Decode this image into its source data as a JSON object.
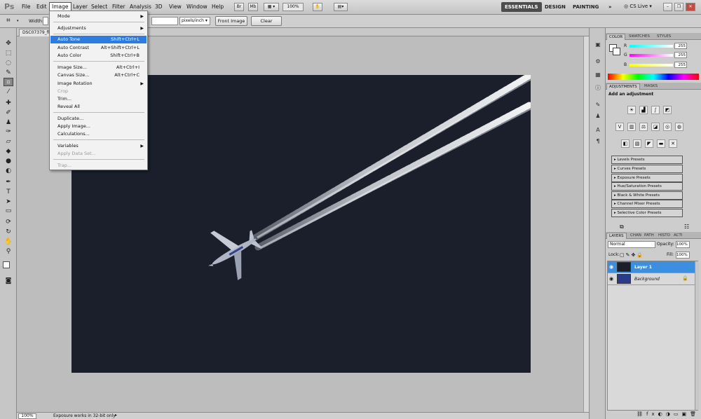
{
  "menubar": {
    "logo": "Ps",
    "items": [
      "File",
      "Edit",
      "Image",
      "Layer",
      "Select",
      "Filter",
      "Analysis",
      "3D",
      "View",
      "Window",
      "Help"
    ],
    "zoom": "100%",
    "workspaces": [
      "ESSENTIALS",
      "DESIGN",
      "PAINTING"
    ],
    "cs_live": "CS Live",
    "more": "»"
  },
  "options": {
    "width_label": "Width:",
    "resolution_units": "pixels/inch",
    "front_image": "Front Image",
    "clear": "Clear"
  },
  "document": {
    "tab_title": "DSC07379_fil",
    "zoom": "100%",
    "status": "Exposure works in 32-bit only"
  },
  "image_menu": {
    "items": [
      {
        "label": "Mode",
        "shortcut": "",
        "submenu": true,
        "disabled": false
      },
      {
        "label": "Adjustments",
        "shortcut": "",
        "submenu": true,
        "disabled": false
      },
      {
        "label": "Auto Tone",
        "shortcut": "Shift+Ctrl+L",
        "submenu": false,
        "disabled": false,
        "highlight": true
      },
      {
        "label": "Auto Contrast",
        "shortcut": "Alt+Shift+Ctrl+L",
        "submenu": false,
        "disabled": false
      },
      {
        "label": "Auto Color",
        "shortcut": "Shift+Ctrl+B",
        "submenu": false,
        "disabled": false
      },
      {
        "label": "Image Size...",
        "shortcut": "Alt+Ctrl+I",
        "submenu": false,
        "disabled": false
      },
      {
        "label": "Canvas Size...",
        "shortcut": "Alt+Ctrl+C",
        "submenu": false,
        "disabled": false
      },
      {
        "label": "Image Rotation",
        "shortcut": "",
        "submenu": true,
        "disabled": false
      },
      {
        "label": "Crop",
        "shortcut": "",
        "submenu": false,
        "disabled": true
      },
      {
        "label": "Trim...",
        "shortcut": "",
        "submenu": false,
        "disabled": false
      },
      {
        "label": "Reveal All",
        "shortcut": "",
        "submenu": false,
        "disabled": false
      },
      {
        "label": "Duplicate...",
        "shortcut": "",
        "submenu": false,
        "disabled": false
      },
      {
        "label": "Apply Image...",
        "shortcut": "",
        "submenu": false,
        "disabled": false
      },
      {
        "label": "Calculations...",
        "shortcut": "",
        "submenu": false,
        "disabled": false
      },
      {
        "label": "Variables",
        "shortcut": "",
        "submenu": true,
        "disabled": false
      },
      {
        "label": "Apply Data Set...",
        "shortcut": "",
        "submenu": false,
        "disabled": true
      },
      {
        "label": "Trap...",
        "shortcut": "",
        "submenu": false,
        "disabled": true
      }
    ]
  },
  "color_panel": {
    "tabs": [
      "COLOR",
      "SWATCHES",
      "STYLES"
    ],
    "channels": [
      {
        "label": "R",
        "value": "255"
      },
      {
        "label": "G",
        "value": "255"
      },
      {
        "label": "B",
        "value": "255"
      }
    ]
  },
  "adjustments_panel": {
    "tabs": [
      "ADJUSTMENTS",
      "MASKS"
    ],
    "heading": "Add an adjustment",
    "presets": [
      "Levels Presets",
      "Curves Presets",
      "Exposure Presets",
      "Hue/Saturation Presets",
      "Black & White Presets",
      "Channel Mixer Presets",
      "Selective Color Presets"
    ]
  },
  "layers_panel": {
    "tabs": [
      "LAYERS",
      "CHAN",
      "PATH",
      "HISTO",
      "ACTI"
    ],
    "blend_mode": "Normal",
    "opacity_label": "Opacity:",
    "opacity": "100%",
    "lock_label": "Lock:",
    "fill_label": "Fill:",
    "fill": "100%",
    "layers": [
      {
        "name": "Layer 1",
        "selected": true
      },
      {
        "name": "Background",
        "selected": false
      }
    ]
  },
  "colors": {
    "highlight": "#2f7ce0",
    "workspace_active": "#4d4d4d",
    "photo_bg": "#1b1f2c"
  }
}
